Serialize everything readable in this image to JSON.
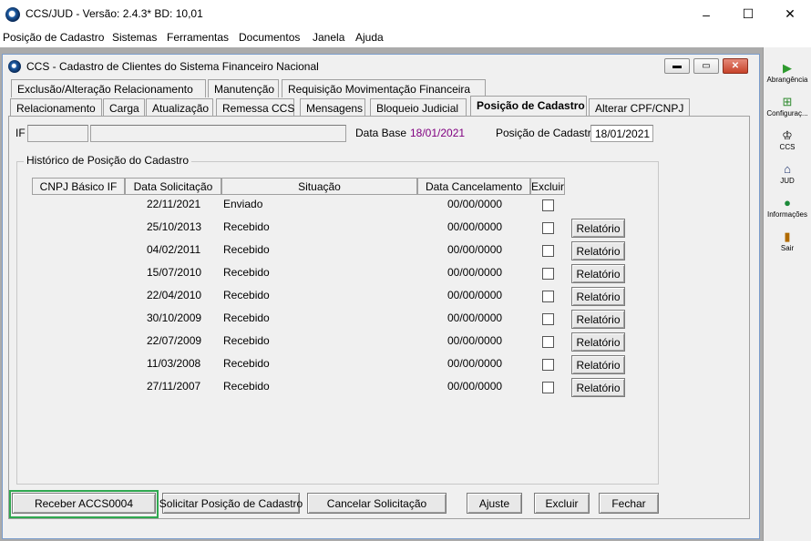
{
  "app": {
    "title": "CCS/JUD - Versão: 2.4.3* BD: 10,01"
  },
  "window_controls": {
    "minimize": "–",
    "maximize": "☐",
    "close": "✕"
  },
  "menu": [
    "Posição de Cadastro",
    "Sistemas",
    "Ferramentas",
    "Documentos",
    "Janela",
    "Ajuda"
  ],
  "toolbar": [
    {
      "label": "Abrangência",
      "icon": "play-green-icon"
    },
    {
      "label": "Configuraç...",
      "icon": "config-grid-icon"
    },
    {
      "label": "CCS",
      "icon": "ccs-icon"
    },
    {
      "label": "JUD",
      "icon": "bank-icon"
    },
    {
      "label": "Informações",
      "icon": "globe-icon"
    },
    {
      "label": "Sair",
      "icon": "exit-door-icon"
    }
  ],
  "child": {
    "title": "CCS - Cadastro de Clientes do Sistema Financeiro Nacional",
    "tabs_row1": [
      "Exclusão/Alteração Relacionamento",
      "Manutenção",
      "Requisição Movimentação Financeira"
    ],
    "tabs_row2": [
      "Relacionamento",
      "Carga",
      "Atualização",
      "Remessa CCS",
      "Mensagens",
      "Bloqueio Judicial",
      "Posição de Cadastro",
      "Alterar CPF/CNPJ"
    ],
    "active_tab": "Posição de Cadastro"
  },
  "form": {
    "if_label": "IF",
    "if_code": "",
    "if_name": "",
    "data_base_label": "Data Base",
    "data_base_value": "18/01/2021",
    "posicao_label": "Posição de Cadastro:",
    "posicao_value": "18/01/2021"
  },
  "history": {
    "title": "Histórico de Posição do Cadastro",
    "columns": [
      "CNPJ Básico IF",
      "Data Solicitação",
      "Situação",
      "Data Cancelamento",
      "Excluir"
    ],
    "rows": [
      {
        "cnpj": "",
        "data": "22/11/2021",
        "situacao": "Enviado",
        "cancelamento": "00/00/0000",
        "relatorio": ""
      },
      {
        "cnpj": "",
        "data": "25/10/2013",
        "situacao": "Recebido",
        "cancelamento": "00/00/0000",
        "relatorio": "Relatório"
      },
      {
        "cnpj": "",
        "data": "04/02/2011",
        "situacao": "Recebido",
        "cancelamento": "00/00/0000",
        "relatorio": "Relatório"
      },
      {
        "cnpj": "",
        "data": "15/07/2010",
        "situacao": "Recebido",
        "cancelamento": "00/00/0000",
        "relatorio": "Relatório"
      },
      {
        "cnpj": "",
        "data": "22/04/2010",
        "situacao": "Recebido",
        "cancelamento": "00/00/0000",
        "relatorio": "Relatório"
      },
      {
        "cnpj": "",
        "data": "30/10/2009",
        "situacao": "Recebido",
        "cancelamento": "00/00/0000",
        "relatorio": "Relatório"
      },
      {
        "cnpj": "",
        "data": "22/07/2009",
        "situacao": "Recebido",
        "cancelamento": "00/00/0000",
        "relatorio": "Relatório"
      },
      {
        "cnpj": "",
        "data": "11/03/2008",
        "situacao": "Recebido",
        "cancelamento": "00/00/0000",
        "relatorio": "Relatório"
      },
      {
        "cnpj": "",
        "data": "27/11/2007",
        "situacao": "Recebido",
        "cancelamento": "00/00/0000",
        "relatorio": "Relatório"
      }
    ]
  },
  "buttons": {
    "receber": "Receber ACCS0004",
    "solicitar": "Solicitar Posição de Cadastro",
    "cancelar": "Cancelar Solicitação",
    "ajuste": "Ajuste",
    "excluir": "Excluir",
    "fechar": "Fechar"
  },
  "colors": {
    "data_base_value": "#800080",
    "highlight": "#2fa84f"
  }
}
